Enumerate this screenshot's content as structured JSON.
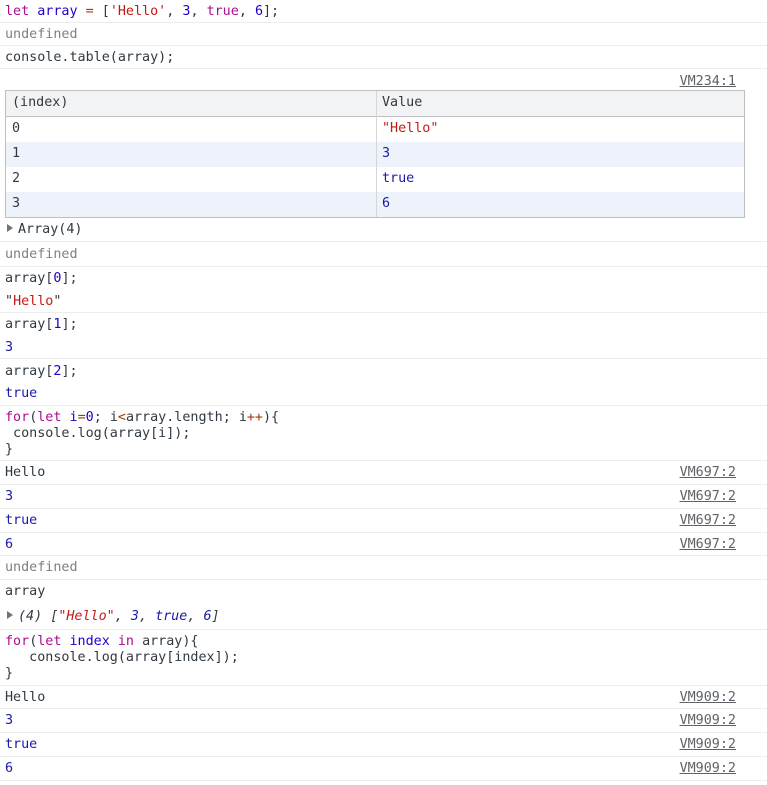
{
  "colors": {
    "keyword": "#aa0d91",
    "variable": "#1c00cf",
    "string": "#c41a16",
    "number": "#1c00cf",
    "undefined": "#808080",
    "link": "#5f6368",
    "table_alt_row": "#eef3fb",
    "table_header": "#f1f3f4"
  },
  "cmd1": {
    "kw": "let",
    "name": "array",
    "eq": "=",
    "open": "[",
    "s": "'Hello'",
    "c1": ",",
    "n3": "3",
    "c2": ",",
    "b": "true",
    "c3": ",",
    "n6": "6",
    "close": "];"
  },
  "undefined_text": "undefined",
  "cmd2": "console.table(array);",
  "src_table": "VM234:1",
  "table": {
    "headers": [
      "(index)",
      "Value"
    ],
    "rows": [
      {
        "index": "0",
        "value": "\"Hello\""
      },
      {
        "index": "1",
        "value": "3"
      },
      {
        "index": "2",
        "value": "true"
      },
      {
        "index": "3",
        "value": "6"
      }
    ]
  },
  "array_summary": "Array(4)",
  "cmd3": {
    "pre": "array[",
    "idx": "0",
    "post": "];"
  },
  "res3": {
    "q1": "\"",
    "s": "Hello",
    "q2": "\""
  },
  "cmd4": {
    "pre": "array[",
    "idx": "1",
    "post": "];"
  },
  "res4": "3",
  "cmd5": {
    "pre": "array[",
    "idx": "2",
    "post": "];"
  },
  "res5": "true",
  "loop1": {
    "for": "for",
    "open": "(",
    "let": "let",
    "i": "i",
    "eq": "=",
    "zero": "0",
    "semi1": "; ",
    "i2": "i",
    "lt": "<",
    "len": "array.length",
    "semi2": "; ",
    "i3": "i",
    "inc": "++",
    "close": "){",
    "body": " console.log(array[i]);",
    "end": "}"
  },
  "log1": [
    {
      "text": "Hello",
      "src": "VM697:2"
    },
    {
      "text": "3",
      "src": "VM697:2"
    },
    {
      "text": "true",
      "src": "VM697:2"
    },
    {
      "text": "6",
      "src": "VM697:2"
    }
  ],
  "cmd6": "array",
  "res6": {
    "count": "(4)",
    "open": " [",
    "s": "\"Hello\"",
    "c1": ", ",
    "n3": "3",
    "c2": ", ",
    "b": "true",
    "c3": ", ",
    "n6": "6",
    "close": "]"
  },
  "loop2": {
    "for": "for",
    "open": "(",
    "let": "let",
    "index": "index",
    "in": "in",
    "arr": "array",
    "close": "){",
    "body": "   console.log(array[index]);",
    "end": "}"
  },
  "log2": [
    {
      "text": "Hello",
      "src": "VM909:2"
    },
    {
      "text": "3",
      "src": "VM909:2"
    },
    {
      "text": "true",
      "src": "VM909:2"
    },
    {
      "text": "6",
      "src": "VM909:2"
    }
  ]
}
